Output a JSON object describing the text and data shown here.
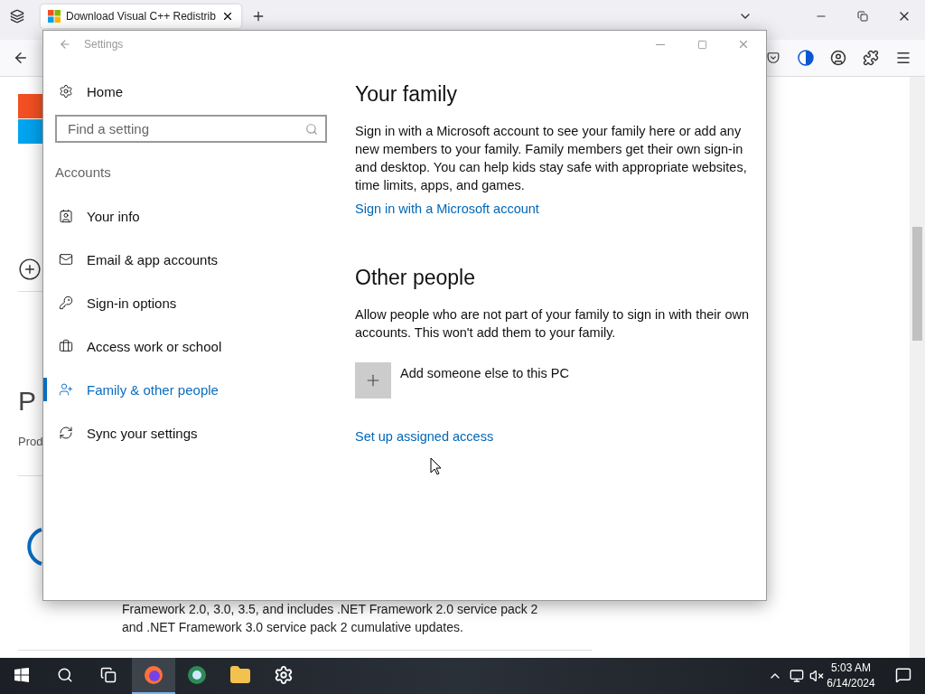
{
  "browser": {
    "tabs": [
      {
        "title": "Download Visual C++ Redistrib",
        "selected": true
      }
    ],
    "page": {
      "heading_fragment": "P",
      "label_fragment": "Prod",
      "description": [
        "Framework 2.0, 3.0, 3.5, and includes .NET Framework 2.0 service pack 2",
        "and .NET Framework 3.0 service pack 2 cumulative updates."
      ]
    }
  },
  "settings": {
    "title": "Settings",
    "home": "Home",
    "search": {
      "placeholder": "Find a setting"
    },
    "section": "Accounts",
    "nav": [
      {
        "label": "Your info",
        "kind": "info",
        "selected": false
      },
      {
        "label": "Email & app accounts",
        "kind": "mail",
        "selected": false
      },
      {
        "label": "Sign-in options",
        "kind": "key",
        "selected": false
      },
      {
        "label": "Access work or school",
        "kind": "work",
        "selected": false
      },
      {
        "label": "Family & other people",
        "kind": "family",
        "selected": true
      },
      {
        "label": "Sync your settings",
        "kind": "sync",
        "selected": false
      }
    ],
    "family": {
      "heading": "Your family",
      "body": "Sign in with a Microsoft account to see your family here or add any new members to your family. Family members get their own sign-in and desktop. You can help kids stay safe with appropriate websites, time limits, apps, and games.",
      "link": "Sign in with a Microsoft account"
    },
    "other": {
      "heading": "Other people",
      "body": "Allow people who are not part of your family to sign in with their own accounts. This won't add them to your family.",
      "add": "Add someone else to this PC",
      "link": "Set up assigned access"
    }
  },
  "taskbar": {
    "apps": [
      {
        "kind": "firefox",
        "selected": true
      },
      {
        "kind": "globe",
        "selected": false
      },
      {
        "kind": "explorer",
        "selected": false
      },
      {
        "kind": "settings",
        "selected": false
      }
    ],
    "clock": {
      "time": "5:03 AM",
      "date": "6/14/2024"
    }
  }
}
